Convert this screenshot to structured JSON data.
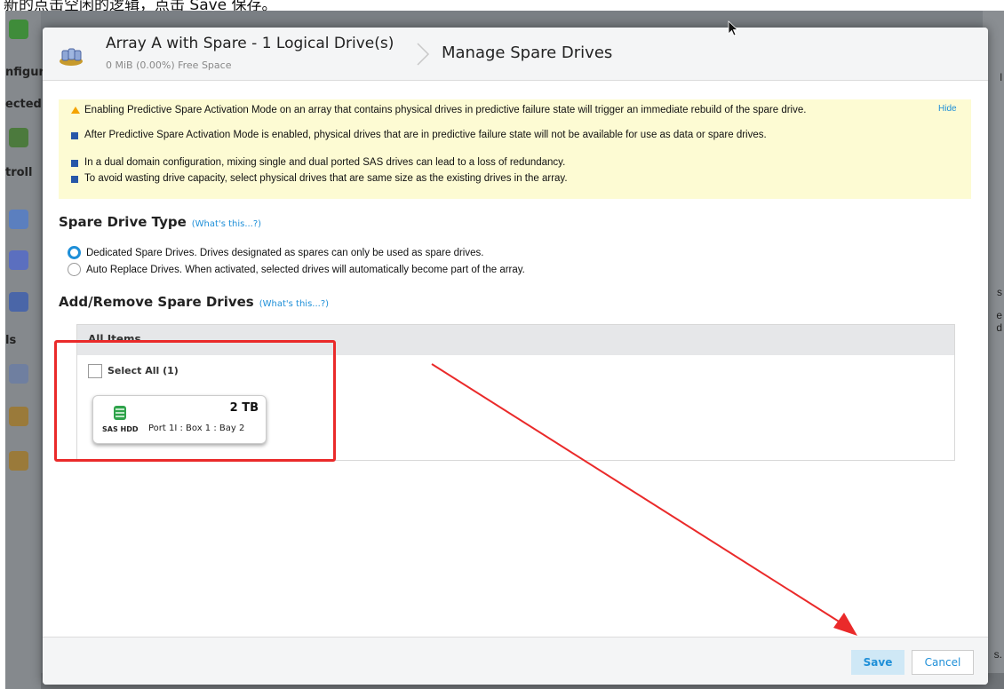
{
  "caption": {
    "text": "新的点击空闲的逻辑，点击 Save 保存。"
  },
  "background": {
    "left_sections": [
      "nfigur",
      "ected",
      "troll",
      "ls"
    ],
    "right_fragments": [
      "l",
      "s",
      "e",
      "d",
      "s."
    ]
  },
  "header": {
    "array_title": "Array A with Spare - 1 Logical Drive(s)",
    "array_subtitle": "0 MiB (0.00%) Free Space",
    "page_title": "Manage Spare Drives"
  },
  "warnings": {
    "items": [
      "Enabling Predictive Spare Activation Mode on an array that contains physical drives in predictive failure state will trigger an immediate rebuild of the spare drive.",
      "After Predictive Spare Activation Mode is enabled, physical drives that are in predictive failure state will not be available for use as data or spare drives.",
      "In a dual domain configuration, mixing single and dual ported SAS drives can lead to a loss of redundancy.",
      "To avoid wasting drive capacity, select physical drives that are same size as the existing drives in the array."
    ],
    "hide_label": "Hide"
  },
  "spare_type": {
    "title": "Spare Drive Type",
    "help_link": "(What's this...?)",
    "options": [
      "Dedicated Spare Drives. Drives designated as spares can only be used as spare drives.",
      "Auto Replace Drives. When activated, selected drives will automatically become part of the array."
    ],
    "selected_index": 0
  },
  "add_remove": {
    "title": "Add/Remove Spare Drives",
    "help_link": "(What's this...?)",
    "panel_header": "All Items",
    "select_all_label": "Select All (1)",
    "drive": {
      "size": "2 TB",
      "type": "SAS HDD",
      "location": "Port 1I : Box 1 : Bay 2"
    }
  },
  "footer": {
    "save_label": "Save",
    "cancel_label": "Cancel"
  },
  "colors": {
    "accent": "#1e8fd8",
    "warning_bg": "#fdfbd3",
    "annotation": "#ea2a2a"
  }
}
